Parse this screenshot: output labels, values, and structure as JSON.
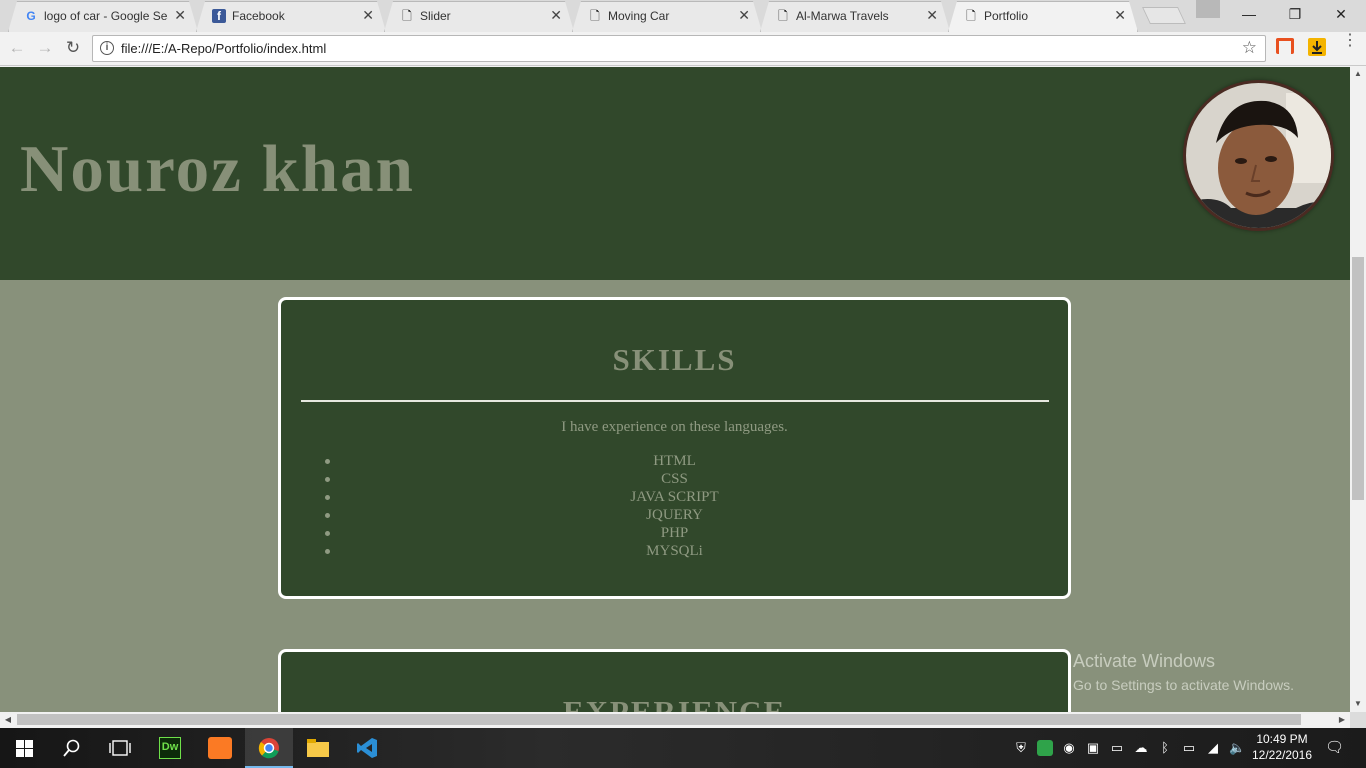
{
  "browser": {
    "tabs": [
      {
        "title": "logo of car - Google Sea",
        "icon": "google-icon",
        "active": false
      },
      {
        "title": "Facebook",
        "icon": "facebook-icon",
        "active": false
      },
      {
        "title": "Slider",
        "icon": "document-icon",
        "active": false
      },
      {
        "title": "Moving Car",
        "icon": "document-icon",
        "active": false
      },
      {
        "title": "Al-Marwa Travels",
        "icon": "document-icon",
        "active": false
      },
      {
        "title": "Portfolio",
        "icon": "document-icon",
        "active": true
      }
    ],
    "url": "file:///E:/A-Repo/Portfolio/index.html",
    "info_glyph": "i",
    "star_glyph": "☆"
  },
  "page": {
    "name": "Nouroz khan",
    "skills": {
      "title": "SKILLS",
      "intro": "I have experience on these languages.",
      "items": [
        "HTML",
        "CSS",
        "JAVA SCRIPT",
        "JQUERY",
        "PHP",
        "MYSQLi"
      ]
    },
    "experience": {
      "title": "EXPERIENCE"
    }
  },
  "watermark": {
    "title": "Activate Windows",
    "subtitle": "Go to Settings to activate Windows."
  },
  "taskbar": {
    "apps": [
      "start-icon",
      "search-icon",
      "task-view-icon",
      "dreamweaver-icon",
      "xampp-icon",
      "chrome-icon",
      "file-explorer-icon",
      "visual-studio-icon"
    ],
    "dreamweaver_label": "Dw",
    "time": "10:49 PM",
    "date": "12/22/2016"
  },
  "colors": {
    "hero_bg": "#31482b",
    "page_bg": "#88917b",
    "muted_text": "#879078",
    "card_border": "#ffffff"
  }
}
